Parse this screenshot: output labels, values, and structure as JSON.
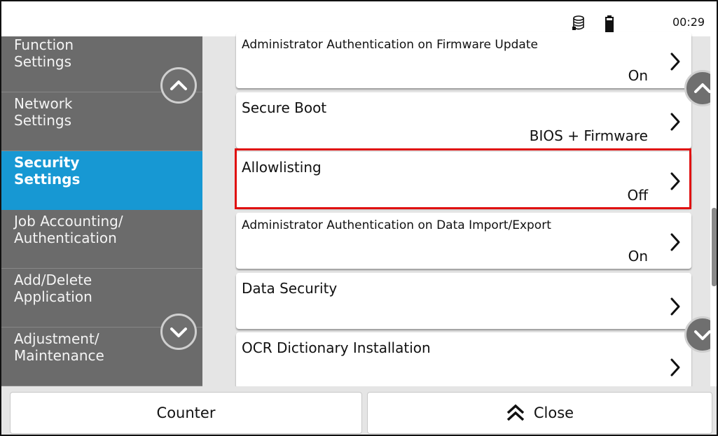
{
  "status_bar": {
    "time": "00:29",
    "icons": [
      "database-icon",
      "battery-icon"
    ]
  },
  "sidebar": {
    "items": [
      {
        "label": "Function\nSettings",
        "active": false
      },
      {
        "label": "Network\nSettings",
        "active": false
      },
      {
        "label": "Security\nSettings",
        "active": true
      },
      {
        "label": "Job Accounting/\nAuthentication",
        "active": false
      },
      {
        "label": "Add/Delete\nApplication",
        "active": false
      },
      {
        "label": "Adjustment/\nMaintenance",
        "active": false
      }
    ],
    "scroll_icons": [
      "chevron-up-icon",
      "chevron-down-icon"
    ]
  },
  "settings_list": {
    "rows": [
      {
        "title": "Administrator Authentication on Firmware Update",
        "value": "On"
      },
      {
        "title": "Secure Boot",
        "value": "BIOS + Firmware"
      },
      {
        "title": "Allowlisting",
        "value": "Off",
        "highlighted": true
      },
      {
        "title": "Administrator Authentication on Data Import/Export",
        "value": "On"
      },
      {
        "title": "Data Security",
        "value": ""
      },
      {
        "title": "OCR Dictionary Installation",
        "value": ""
      }
    ],
    "highlight_color": "#e01010"
  },
  "bottom_bar": {
    "counter_label": "Counter",
    "close_label": "Close",
    "close_icon": "double-chevron-up-icon"
  },
  "colors": {
    "sidebar_bg": "#6b6b6b",
    "active_item": "#1798d3",
    "list_bg": "#e5e5e5"
  }
}
